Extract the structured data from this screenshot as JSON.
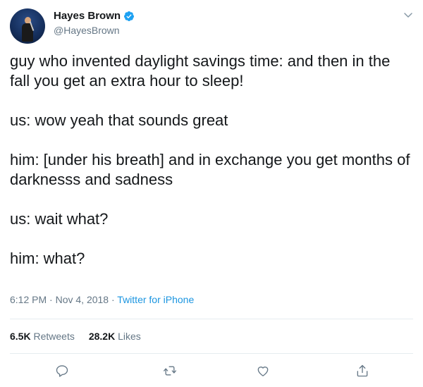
{
  "author": {
    "display_name": "Hayes Brown",
    "handle": "@HayesBrown",
    "verified": true
  },
  "tweet": {
    "paragraphs": [
      "guy who invented daylight savings time: and then in the fall you get an extra hour to sleep!",
      "us: wow yeah that sounds great",
      "him: [under his breath] and in exchange you get months of darknesss and sadness",
      "us: wait what?",
      "him: what?"
    ],
    "time": "6:12 PM",
    "date": "Nov 4, 2018",
    "separator": "·",
    "source": "Twitter for iPhone"
  },
  "stats": {
    "retweets_count": "6.5K",
    "retweets_label": "Retweets",
    "likes_count": "28.2K",
    "likes_label": "Likes"
  },
  "actions": [
    {
      "icon": "reply-icon"
    },
    {
      "icon": "retweet-icon"
    },
    {
      "icon": "like-icon"
    },
    {
      "icon": "share-icon"
    }
  ],
  "colors": {
    "text": "#14171a",
    "secondary": "#657786",
    "accent": "#1b95e0",
    "verified_badge": "#1da1f2",
    "divider": "#e6ecf0"
  }
}
